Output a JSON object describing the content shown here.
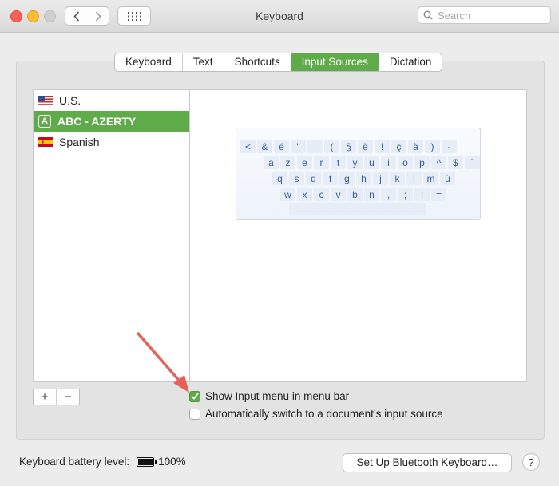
{
  "window": {
    "title": "Keyboard",
    "search_placeholder": "Search"
  },
  "tabs": [
    {
      "label": "Keyboard",
      "active": false
    },
    {
      "label": "Text",
      "active": false
    },
    {
      "label": "Shortcuts",
      "active": false
    },
    {
      "label": "Input Sources",
      "active": true
    },
    {
      "label": "Dictation",
      "active": false
    }
  ],
  "input_sources": [
    {
      "label": "U.S.",
      "icon": "us-flag-icon",
      "selected": false
    },
    {
      "label": "ABC - AZERTY",
      "icon": "abc-letter-icon",
      "icon_glyph": "A",
      "selected": true
    },
    {
      "label": "Spanish",
      "icon": "spain-flag-icon",
      "selected": false
    }
  ],
  "keyboard_preview": {
    "rows": [
      [
        "<",
        "&",
        "é",
        "\"",
        "'",
        "(",
        "§",
        "è",
        "!",
        "ç",
        "à",
        ")",
        "-"
      ],
      [
        "a",
        "z",
        "e",
        "r",
        "t",
        "y",
        "u",
        "i",
        "o",
        "p",
        "^",
        "$",
        "`"
      ],
      [
        "q",
        "s",
        "d",
        "f",
        "g",
        "h",
        "j",
        "k",
        "l",
        "m",
        "ù"
      ],
      [
        "w",
        "x",
        "c",
        "v",
        "b",
        "n",
        ",",
        ";",
        ":",
        "="
      ]
    ]
  },
  "list_controls": {
    "add": "+",
    "remove": "−"
  },
  "options": {
    "show_input_menu": {
      "label": "Show Input menu in menu bar",
      "checked": true
    },
    "auto_switch": {
      "label": "Automatically switch to a document’s input source",
      "checked": false
    }
  },
  "footer": {
    "battery_label": "Keyboard battery level:",
    "battery_value": "100%",
    "battery_level": 1.0,
    "bluetooth_button": "Set Up Bluetooth Keyboard…",
    "help": "?"
  },
  "colors": {
    "accent": "#5fab49",
    "annotation_arrow": "#e8605a"
  }
}
